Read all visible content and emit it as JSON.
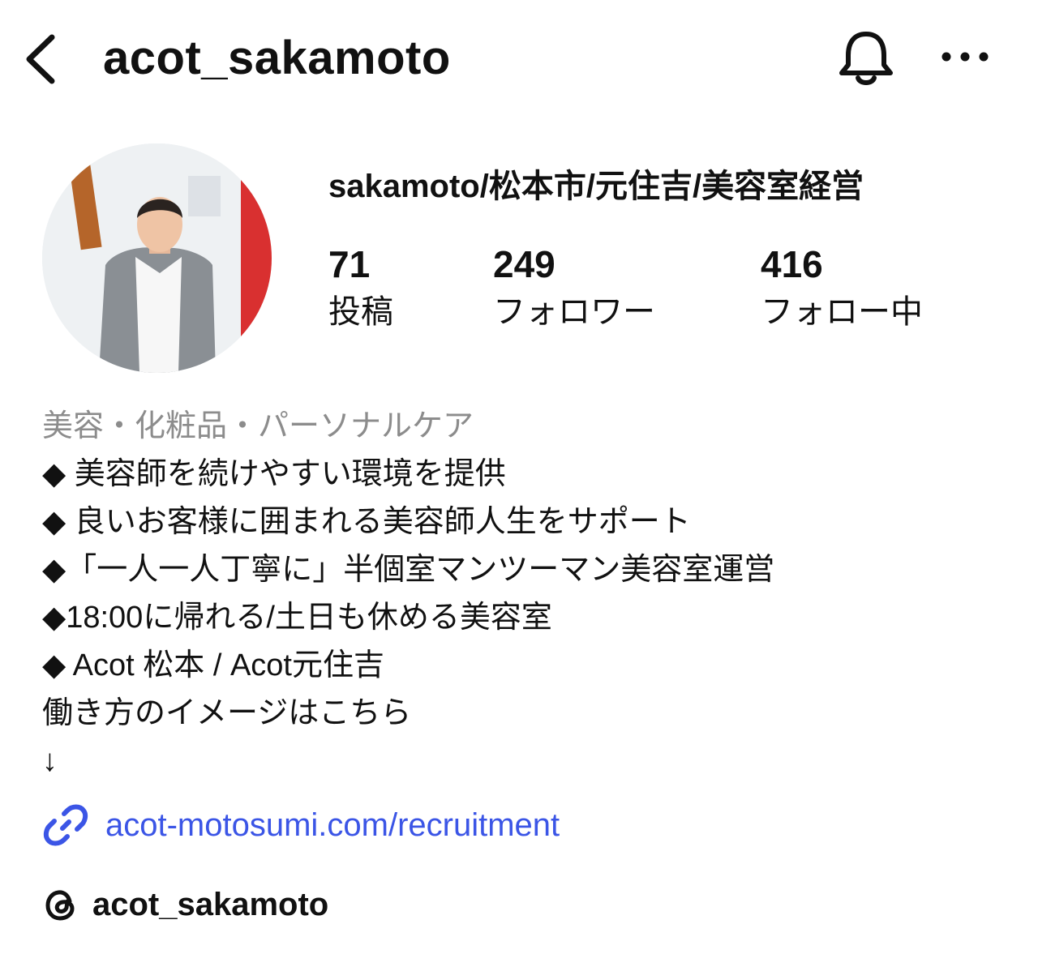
{
  "header": {
    "title": "acot_sakamoto",
    "back_icon": "chevron-left-icon",
    "bell_icon": "bell-icon",
    "more_icon": "more-horizontal-icon"
  },
  "profile": {
    "display_name": "sakamoto/松本市/元住吉/美容室経営",
    "avatar_icon": "profile-photo"
  },
  "stats": {
    "posts": {
      "count": "71",
      "label": "投稿"
    },
    "followers": {
      "count": "249",
      "label": "フォロワー"
    },
    "following": {
      "count": "416",
      "label": "フォロー中"
    }
  },
  "bio": {
    "category": "美容・化粧品・パーソナルケア",
    "lines": [
      "◆ 美容師を続けやすい環境を提供",
      "◆ 良いお客様に囲まれる美容師人生をサポート",
      "◆「一人一人丁寧に」半個室マンツーマン美容室運営",
      "◆18:00に帰れる/土日も休める美容室",
      "◆ Acot 松本 / Acot元住吉",
      "働き方のイメージはこちら",
      "↓"
    ]
  },
  "link": {
    "icon": "link-icon",
    "text": "acot-motosumi.com/recruitment",
    "color": "#3b55e6"
  },
  "threads": {
    "icon": "threads-icon",
    "handle": "acot_sakamoto"
  },
  "colors": {
    "text": "#111111",
    "category": "#8c8c8c",
    "link": "#3b55e6"
  }
}
